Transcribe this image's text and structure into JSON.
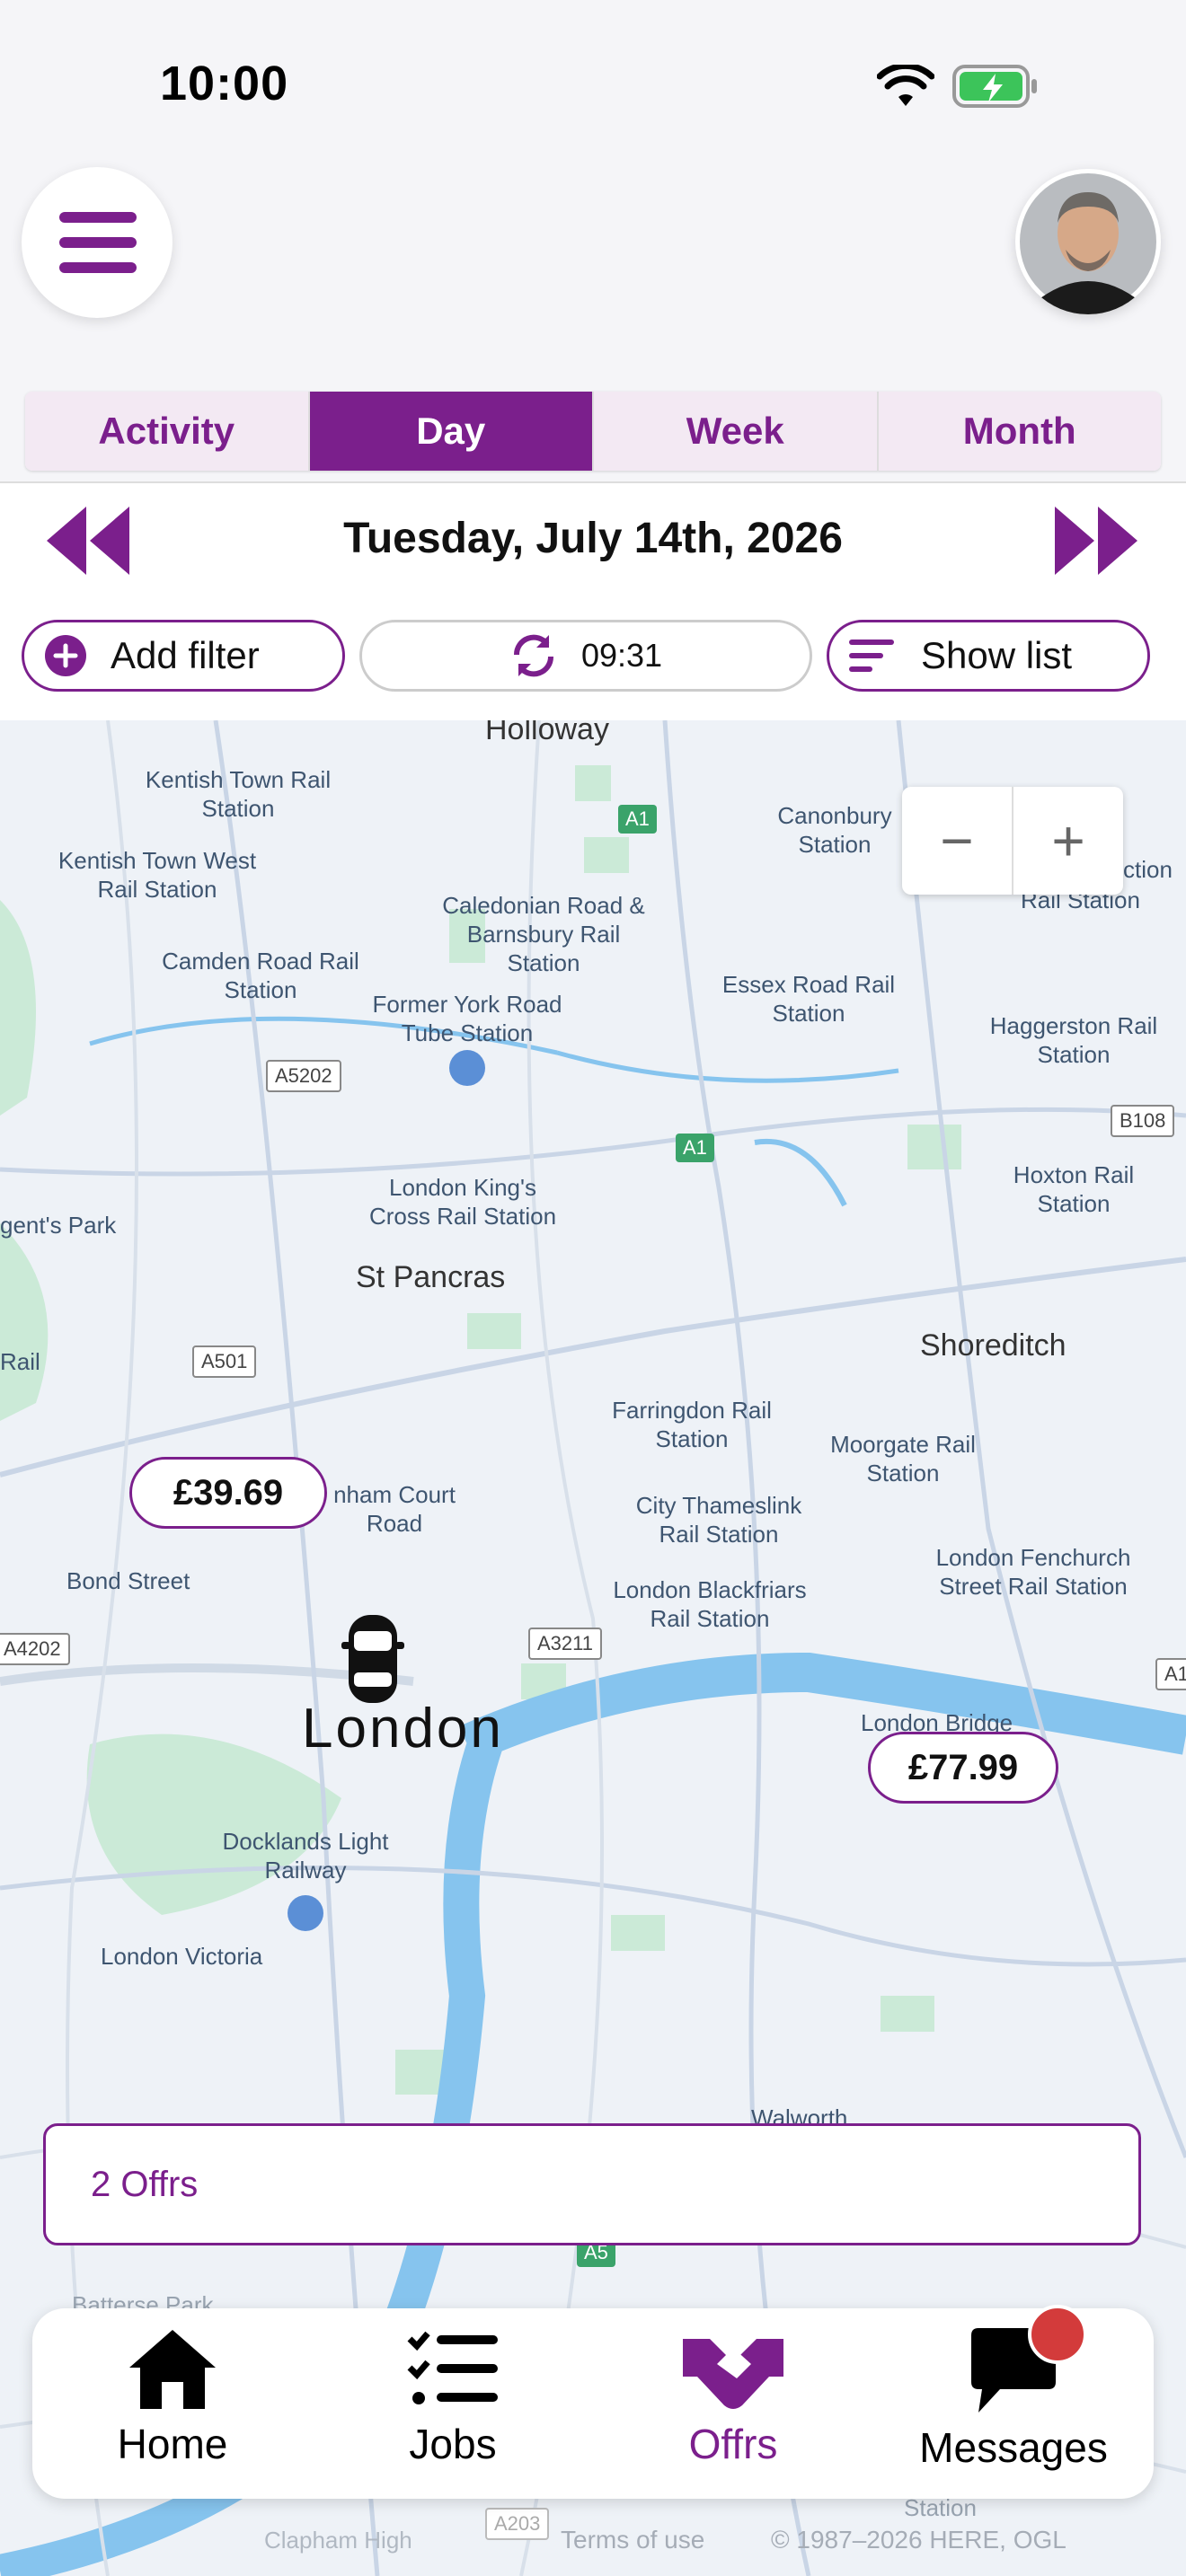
{
  "status": {
    "time": "10:00"
  },
  "tabs": [
    {
      "label": "Activity",
      "active": false
    },
    {
      "label": "Day",
      "active": true
    },
    {
      "label": "Week",
      "active": false
    },
    {
      "label": "Month",
      "active": false
    }
  ],
  "date": {
    "label": "Tuesday, July 14th, 2026"
  },
  "filters": {
    "add_filter": "Add filter",
    "refresh_time": "09:31",
    "show_list": "Show list"
  },
  "map": {
    "labels": [
      "Holloway",
      "Kentish Town Rail Station",
      "Kentish Town West Rail Station",
      "Caledonian Road & Barnsbury Rail Station",
      "Canonbury Station",
      "Camden Road Rail Station",
      "Former York Road Tube Station",
      "Essex Road Rail Station",
      "Haggerston Rail Station",
      "London King's Cross Rail Station",
      "Hoxton Rail Station",
      "St Pancras",
      "Shoreditch",
      "Farringdon Rail Station",
      "Moorgate Rail Station",
      "City Thameslink Rail Station",
      "London Blackfriars Rail Station",
      "London Fenchurch Street Rail Station",
      "Bond Street",
      "London Bridge",
      "Docklands Light Railway",
      "London Victoria",
      "Walworth",
      "Batterse Park",
      "gent's Park",
      "nham Court Road",
      "Rail Station",
      "ction",
      "Rail",
      "Station",
      "Clapham High"
    ],
    "roads": [
      "A1",
      "A5202",
      "A501",
      "A3211",
      "B108",
      "A4202",
      "A1",
      "A5",
      "A203",
      "A1"
    ],
    "city": "London",
    "prices": [
      "£39.69",
      "£77.99"
    ],
    "zoom_out": "−",
    "zoom_in": "+"
  },
  "offers_bar": {
    "label": "2 Offrs"
  },
  "nav": [
    {
      "label": "Home",
      "icon": "house-icon",
      "active": false
    },
    {
      "label": "Jobs",
      "icon": "checklist-icon",
      "active": false
    },
    {
      "label": "Offrs",
      "icon": "handshake-icon",
      "active": true
    },
    {
      "label": "Messages",
      "icon": "chat-bubble-icon",
      "active": false
    }
  ],
  "footer": {
    "terms": "Terms of use",
    "copyright": "© 1987–2026 HERE, OGL"
  },
  "colors": {
    "accent": "#7b1f8c",
    "badge": "#d33b3b",
    "river": "#86c4ee",
    "park": "#cbead7"
  }
}
